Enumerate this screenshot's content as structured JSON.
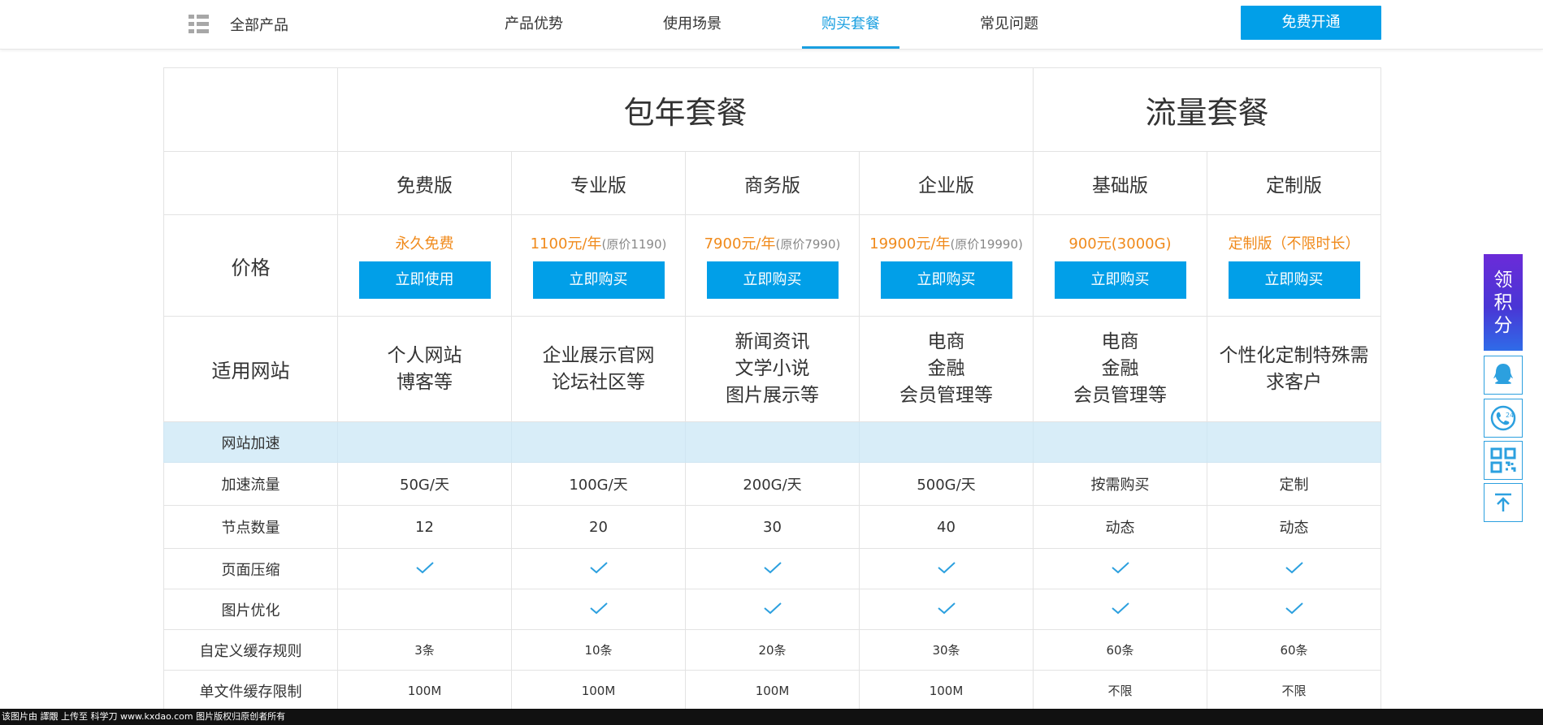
{
  "nav": {
    "all_products": "全部产品",
    "tabs": [
      {
        "label": "产品优势"
      },
      {
        "label": "使用场景"
      },
      {
        "label": "购买套餐",
        "active": true
      },
      {
        "label": "常见问题"
      }
    ],
    "cta": "免费开通"
  },
  "table": {
    "groups": [
      "包年套餐",
      "流量套餐"
    ],
    "versions": [
      "免费版",
      "专业版",
      "商务版",
      "企业版",
      "基础版",
      "定制版"
    ],
    "price_label": "价格",
    "prices": [
      {
        "price": "永久免费",
        "orig": "",
        "button": "立即使用"
      },
      {
        "price": "1100元/年",
        "orig": "(原价1190)",
        "button": "立即购买"
      },
      {
        "price": "7900元/年",
        "orig": "(原价7990)",
        "button": "立即购买"
      },
      {
        "price": "19900元/年",
        "orig": "(原价19990)",
        "button": "立即购买"
      },
      {
        "price": "900元(3000G)",
        "orig": "",
        "button": "立即购买"
      },
      {
        "price": "定制版（不限时长）",
        "orig": "",
        "button": "立即购买"
      }
    ],
    "site_label": "适用网站",
    "sites": [
      [
        "个人网站",
        "博客等"
      ],
      [
        "企业展示官网",
        "论坛社区等"
      ],
      [
        "新闻资讯",
        "文学小说",
        "图片展示等"
      ],
      [
        "电商",
        "金融",
        "会员管理等"
      ],
      [
        "电商",
        "金融",
        "会员管理等"
      ],
      [
        "个性化定制特殊需",
        "求客户"
      ]
    ],
    "section_label": "网站加速",
    "features": [
      {
        "label": "加速流量",
        "values": [
          "50G/天",
          "100G/天",
          "200G/天",
          "500G/天",
          "按需购买",
          "定制"
        ]
      },
      {
        "label": "节点数量",
        "values": [
          "12",
          "20",
          "30",
          "40",
          "动态",
          "动态"
        ]
      },
      {
        "label": "页面压缩",
        "checks": [
          true,
          true,
          true,
          true,
          true,
          true
        ]
      },
      {
        "label": "图片优化",
        "checks": [
          false,
          true,
          true,
          true,
          true,
          true
        ]
      },
      {
        "label": "自定义缓存规则",
        "values": [
          "3条",
          "10条",
          "20条",
          "30条",
          "60条",
          "60条"
        ]
      },
      {
        "label": "单文件缓存限制",
        "values": [
          "100M",
          "100M",
          "100M",
          "100M",
          "不限",
          "不限"
        ]
      }
    ]
  },
  "side": {
    "points": [
      "领",
      "积",
      "分"
    ],
    "icons": [
      "qq-icon",
      "phone-24-icon",
      "qrcode-icon",
      "back-to-top-icon"
    ]
  },
  "footer": "该图片由 譯覵 上传至 科学刀 www.kxdao.com 图片版权归原创者所有",
  "colors": {
    "accent": "#019fe8",
    "price": "#f08a1b",
    "section_bg": "#d8edf8"
  }
}
